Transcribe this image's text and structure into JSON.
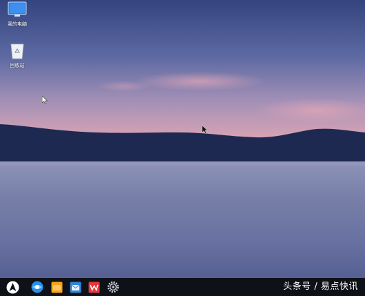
{
  "desktop": {
    "icons": [
      {
        "label": "我的电脑",
        "icon": "computer-icon"
      },
      {
        "label": "回收站",
        "icon": "recycle-bin-icon"
      }
    ]
  },
  "taskbar": {
    "items": [
      {
        "icon": "start-menu-icon"
      },
      {
        "icon": "browser-icon"
      },
      {
        "icon": "file-manager-icon"
      },
      {
        "icon": "mail-icon"
      },
      {
        "icon": "wps-office-icon"
      },
      {
        "icon": "settings-icon"
      }
    ]
  },
  "watermark": {
    "text": "头条号 / 易点快讯"
  },
  "colors": {
    "taskbar": "#0e1118",
    "sky_top": "#3d4e86",
    "sky_pink": "#d9a0b0",
    "mountain": "#1e2a52",
    "water": "#6c75a0"
  }
}
